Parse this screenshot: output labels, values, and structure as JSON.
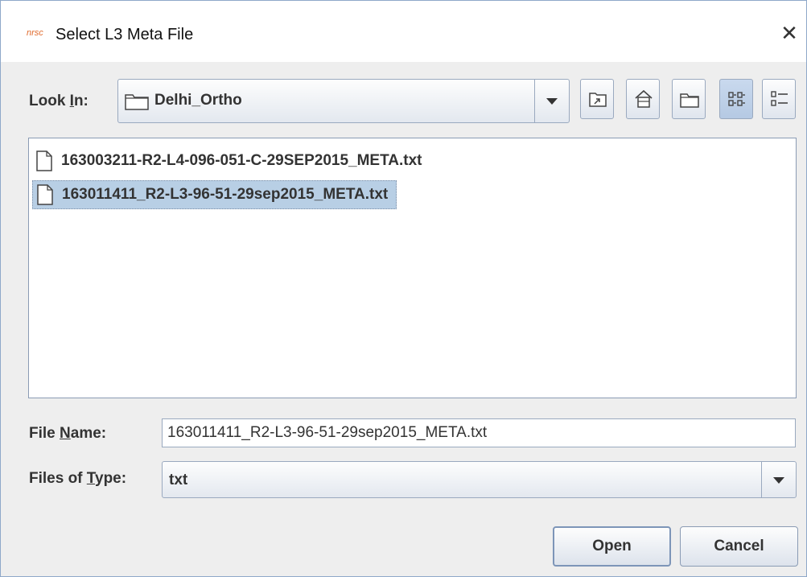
{
  "window": {
    "app_logo": "nrsc",
    "title": "Select L3 Meta File",
    "close_glyph": "✕"
  },
  "look_in": {
    "label_pre": "Look ",
    "label_mnemonic": "I",
    "label_post": "n:",
    "value": "Delhi_Ortho",
    "icon": "folder-icon"
  },
  "toolbar": {
    "buttons": [
      {
        "name": "up-one-level-icon",
        "selected": false
      },
      {
        "name": "home-icon",
        "selected": false
      },
      {
        "name": "new-folder-icon",
        "selected": false
      },
      {
        "name": "list-view-icon",
        "selected": true
      },
      {
        "name": "details-view-icon",
        "selected": false
      }
    ]
  },
  "files": [
    {
      "name": "163003211-R2-L4-096-051-C-29SEP2015_META.txt",
      "selected": false
    },
    {
      "name": "163011411_R2-L3-96-51-29sep2015_META.txt",
      "selected": true
    }
  ],
  "file_name": {
    "label_pre": "File ",
    "label_mnemonic": "N",
    "label_post": "ame:",
    "value": "163011411_R2-L3-96-51-29sep2015_META.txt"
  },
  "file_type": {
    "label_pre": "Files of ",
    "label_mnemonic": "T",
    "label_post": "ype:",
    "value": "txt"
  },
  "buttons": {
    "open": "Open",
    "cancel": "Cancel"
  }
}
